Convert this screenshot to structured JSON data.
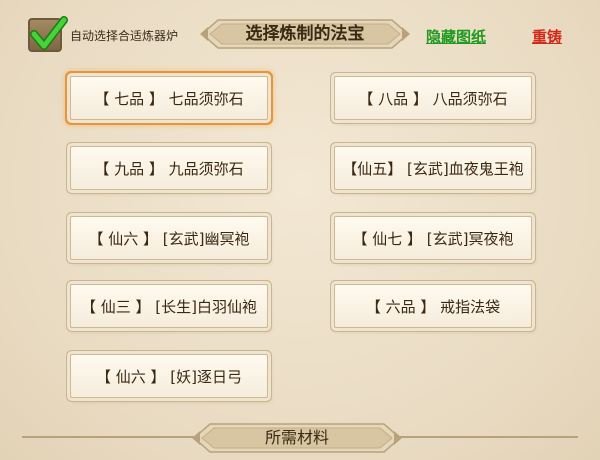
{
  "header": {
    "auto_select_label": "自动选择合适炼器炉",
    "auto_select_checked": true,
    "title": "选择炼制的法宝",
    "hide_drawings_label": "隐藏图纸",
    "recast_label": "重铸"
  },
  "items": [
    {
      "label": "【 七品 】 七品须弥石",
      "selected": true
    },
    {
      "label": "【 八品 】 八品须弥石",
      "selected": false
    },
    {
      "label": "【 九品 】 九品须弥石",
      "selected": false
    },
    {
      "label": "【仙五】 [玄武]血夜鬼王袍",
      "selected": false
    },
    {
      "label": "【 仙六 】 [玄武]幽冥袍",
      "selected": false
    },
    {
      "label": "【 仙七 】 [玄武]冥夜袍",
      "selected": false
    },
    {
      "label": "【 仙三 】 [长生]白羽仙袍",
      "selected": false
    },
    {
      "label": "【 六品 】 戒指法袋",
      "selected": false
    },
    {
      "label": "【 仙六 】 [妖]逐日弓",
      "selected": false
    }
  ],
  "footer": {
    "materials_title": "所需材料"
  },
  "colors": {
    "link_green": "#1f9a1f",
    "link_red": "#d02a1a",
    "selected_glow": "#e8953a",
    "check_green": "#3fc233"
  }
}
